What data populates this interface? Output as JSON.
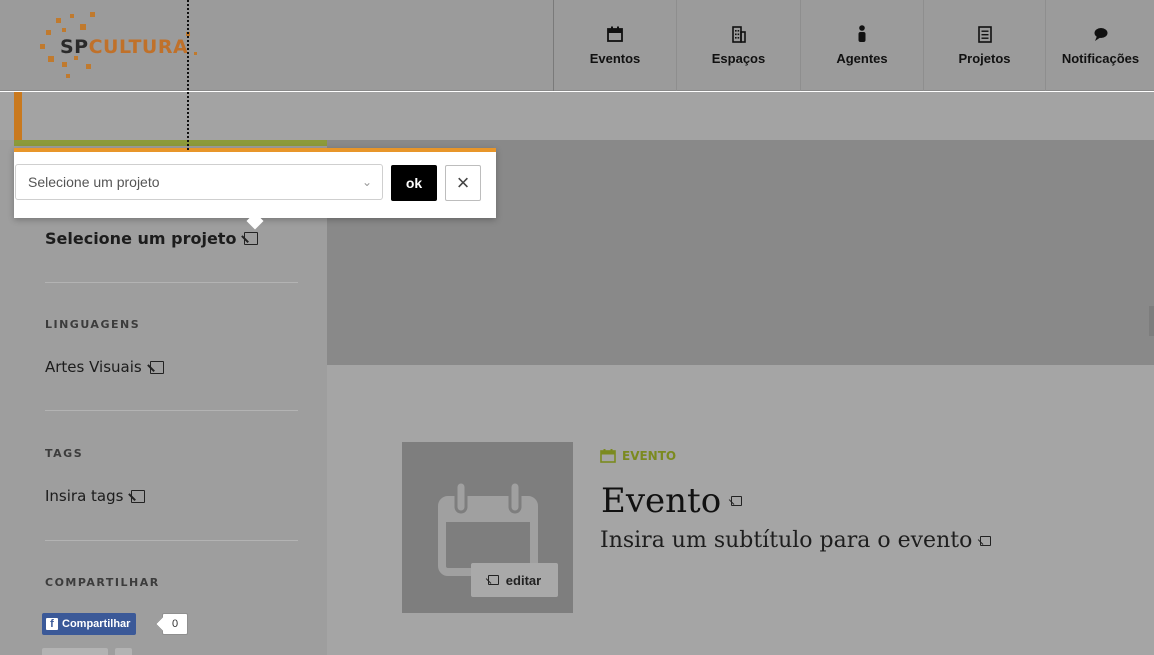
{
  "header": {
    "logo_sp": "SP",
    "logo_cultura": "CULTURA",
    "nav": [
      {
        "label": "Eventos",
        "icon": "calendar-icon"
      },
      {
        "label": "Espaços",
        "icon": "building-icon"
      },
      {
        "label": "Agentes",
        "icon": "person-icon"
      },
      {
        "label": "Projetos",
        "icon": "document-icon"
      },
      {
        "label": "Notificações",
        "icon": "chat-bubble-icon"
      }
    ]
  },
  "popup": {
    "select_placeholder": "Selecione um projeto",
    "ok_label": "ok",
    "close_label": "×"
  },
  "sidebar": {
    "project_value": "Selecione um projeto",
    "linguagens_label": "LINGUAGENS",
    "linguagens_value": "Artes Visuais",
    "tags_label": "TAGS",
    "tags_value": "Insira tags",
    "share_label": "COMPARTILHAR",
    "facebook_label": "Compartilhar",
    "facebook_count": "0"
  },
  "main": {
    "type_label": "EVENTO",
    "title": "Evento",
    "subtitle": "Insira um subtítulo para o evento",
    "edit_label": "editar"
  },
  "colors": {
    "accent_orange": "#e8962a",
    "logo_orange": "#c0712a",
    "event_green": "#7b8a1f",
    "facebook_blue": "#3b5998"
  }
}
